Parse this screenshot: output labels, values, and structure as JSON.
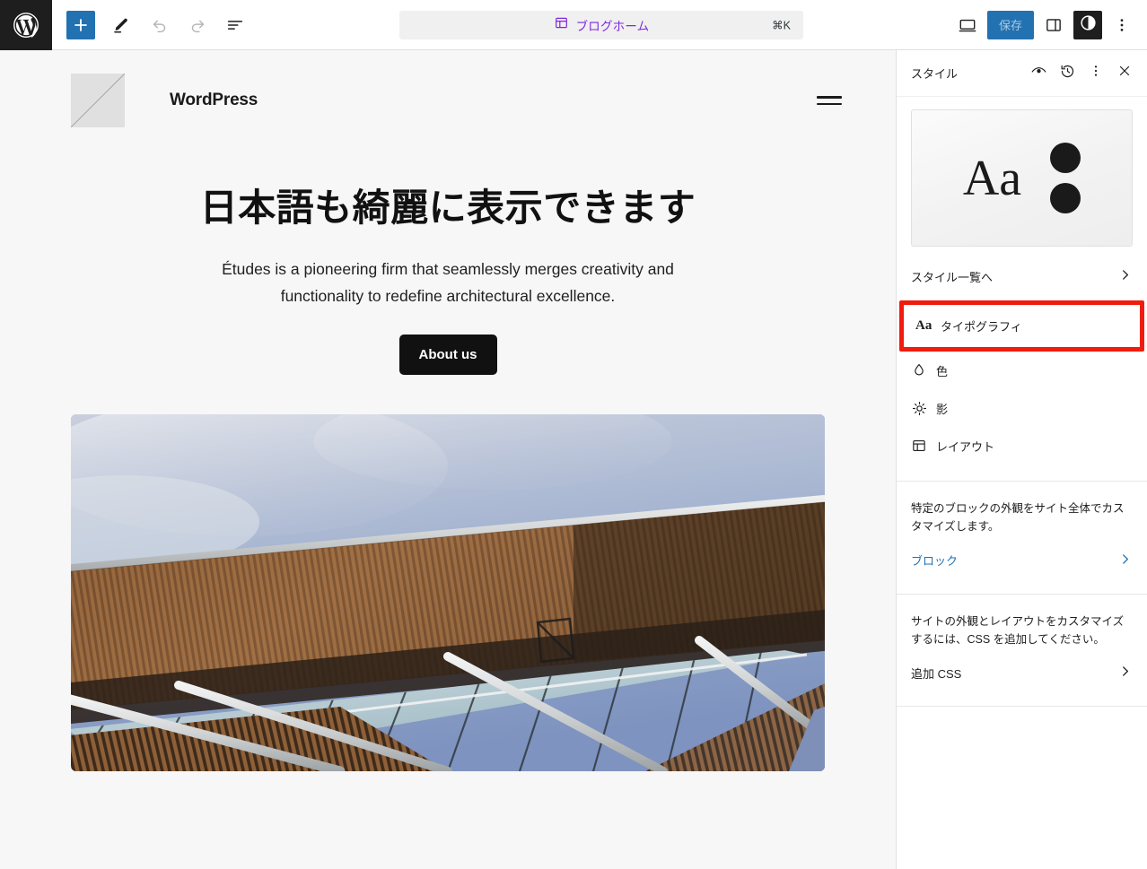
{
  "toolbar": {
    "add_label": "+",
    "command_bar": {
      "label": "ブログホーム",
      "shortcut": "⌘K"
    },
    "save_label": "保存"
  },
  "canvas": {
    "site_title": "WordPress",
    "hero": {
      "heading": "日本語も綺麗に表示できます",
      "paragraph": "Études is a pioneering firm that seamlessly merges creativity and functionality to redefine architectural excellence.",
      "button_label": "About us"
    }
  },
  "sidebar": {
    "title": "スタイル",
    "preview": {
      "sample_text": "Aa"
    },
    "browse": {
      "label": "スタイル一覧へ"
    },
    "items": [
      {
        "label": "タイポグラフィ",
        "icon": "typography-icon"
      },
      {
        "label": "色",
        "icon": "color-droplet-icon"
      },
      {
        "label": "影",
        "icon": "shadow-sun-icon"
      },
      {
        "label": "レイアウト",
        "icon": "layout-icon"
      }
    ],
    "blocks_section": {
      "description": "特定のブロックの外観をサイト全体でカスタマイズします。",
      "link_label": "ブロック"
    },
    "css_section": {
      "description": "サイトの外観とレイアウトをカスタマイズするには、CSS を追加してください。",
      "link_label": "追加 CSS"
    }
  },
  "colors": {
    "accent_blue": "#2271b1",
    "command_purple": "#7f28e0",
    "annotation_red": "#f01c0e",
    "link_blue": "#2271b1"
  }
}
